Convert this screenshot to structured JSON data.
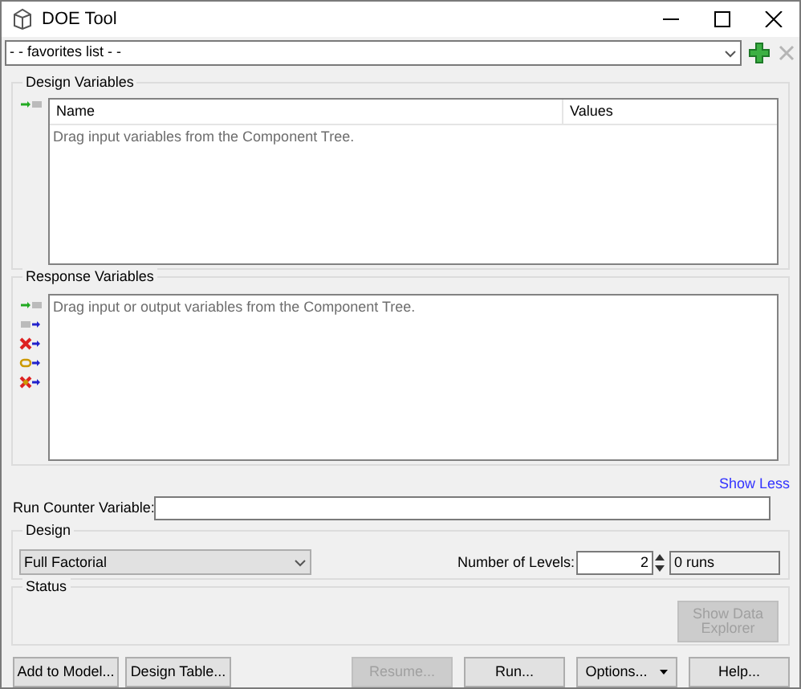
{
  "window": {
    "title": "DOE Tool"
  },
  "favorites": {
    "value": "- - favorites list - -",
    "remove_disabled": true
  },
  "design_variables": {
    "title": "Design Variables",
    "columns": [
      "Name",
      "Values"
    ],
    "hint": "Drag input variables from the Component Tree."
  },
  "response_variables": {
    "title": "Response Variables",
    "hint": "Drag input or output variables from the Component Tree."
  },
  "show_less": "Show Less",
  "run_counter": {
    "label": "Run Counter Variable:"
  },
  "design": {
    "title": "Design",
    "method": "Full Factorial",
    "levels_label": "Number of Levels:",
    "levels": "2",
    "runs": "0 runs"
  },
  "status": {
    "title": "Status",
    "button": {
      "label": "Show Data Explorer",
      "disabled": true
    }
  },
  "left_buttons": [
    {
      "label": "Add to Model...",
      "disabled": false
    },
    {
      "label": "Design Table...",
      "disabled": false
    }
  ],
  "right_buttons": [
    {
      "label": "Resume...",
      "disabled": true,
      "kind": "plain"
    },
    {
      "label": "Run...",
      "disabled": false,
      "kind": "plain"
    },
    {
      "label": "Options...",
      "disabled": false,
      "kind": "dropdown"
    },
    {
      "label": "Help...",
      "disabled": false,
      "kind": "plain"
    }
  ]
}
